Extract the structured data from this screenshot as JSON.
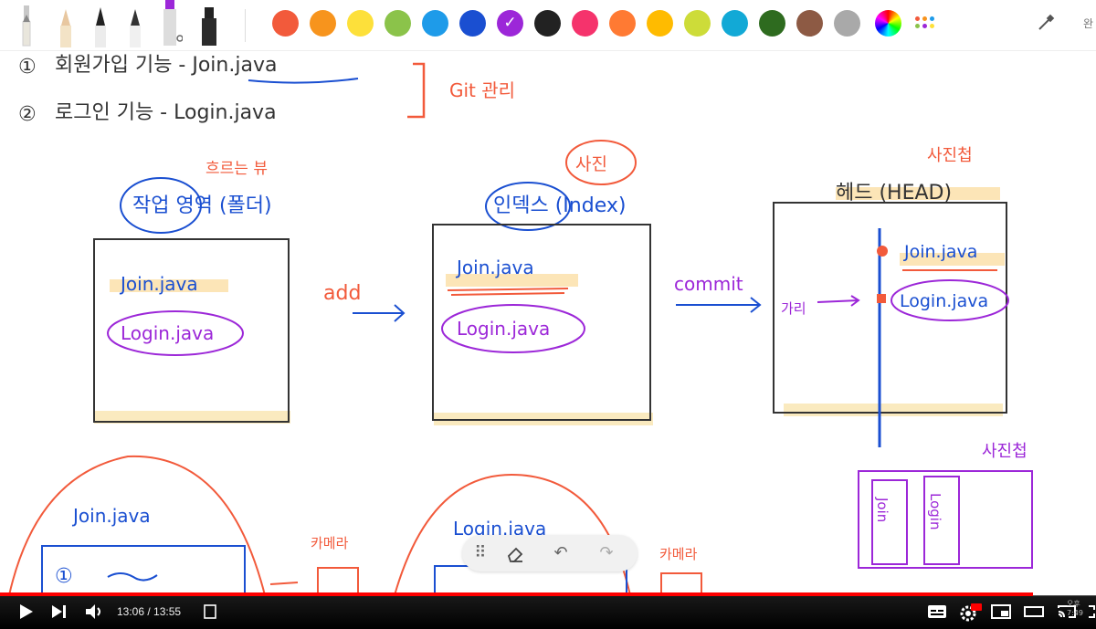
{
  "toolbar": {
    "pens": [
      "pencil-icon",
      "highlighter-icon",
      "fountain-pen-icon",
      "pen-icon",
      "marker-icon",
      "brush-icon"
    ],
    "colors": [
      "#f25a3b",
      "#f7941d",
      "#fde03a",
      "#8bc34a",
      "#1e9be9",
      "#1a4fd1",
      "#9c27d8",
      "#222222",
      "#f5336c",
      "#ff7a33",
      "#ffbb00",
      "#cddc39",
      "#12a9d6",
      "#2e6b1f",
      "#8d5a44",
      "#a9a9a9"
    ],
    "selected_color": "#9c27d8",
    "right_label": "완"
  },
  "whiteboard": {
    "list_item_1_num": "①",
    "list_item_1": "회원가입 기능 - Join.java",
    "list_item_2_num": "②",
    "list_item_2": "로그인 기능 - Login.java",
    "git_note": "Git 관리",
    "flow_note": "흐르는 뷰",
    "working_label": "작업 영역 (폴더)",
    "photo_note": "사진",
    "index_label": "인덱스 (Index)",
    "snapshot_note": "사진첩",
    "head_label": "헤드 (HEAD)",
    "working_file_1": "Join.java",
    "working_file_2": "Login.java",
    "add_label": "add",
    "index_file_1": "Join.java",
    "index_file_2": "Login.java",
    "commit_label": "commit",
    "head_file_1": "Join.java",
    "head_file_2": "Login.java",
    "head_pointer": "가리",
    "album_label": "사진첩",
    "album_spine_1": "Join",
    "album_spine_2": "Login",
    "bottom_file_1": "Join.java",
    "bottom_file_2": "Login.java",
    "camera_note_1": "카메라",
    "camera_note_2": "카메라",
    "bottom_num": "①"
  },
  "player": {
    "current_time": "13:06",
    "separator": " / ",
    "duration": "13:55",
    "progress": 0.9425
  },
  "overlay_clock": "오후 7:49"
}
